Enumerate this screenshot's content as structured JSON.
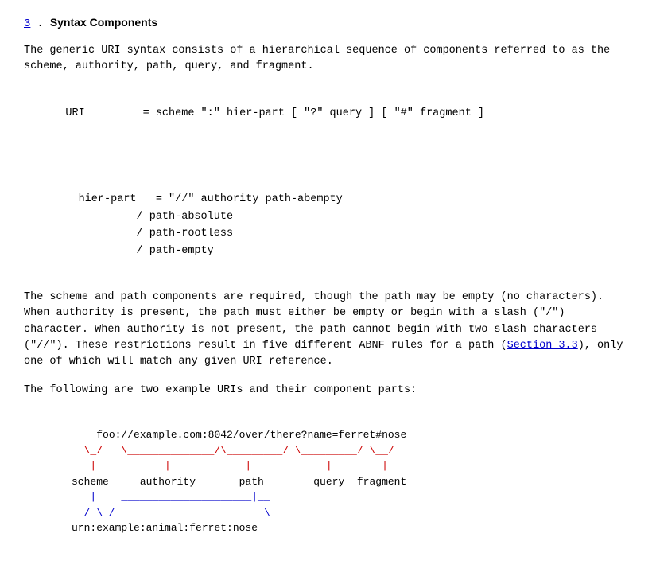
{
  "section": {
    "number": "3",
    "title": "Syntax Components"
  },
  "paragraphs": {
    "intro": "The generic URI syntax consists of a hierarchical sequence of\ncomponents referred to as the scheme, authority, path, query, and\nfragment.",
    "body1": "The scheme and path components are required, though the path may be\nempty (no characters).  When authority is present, the path must\neither be empty or begin with a slash (\"/\") character.  When\nauthority is not present, the path cannot begin with two slash\ncharacters (\"//\").  These restrictions result in five different ABNF\nrules for a path (",
    "section_link": "Section 3.3",
    "body1_cont": "), only one of which will match any\ngiven URI reference.",
    "body2": "The following are two example URIs and their component parts:"
  },
  "grammar": {
    "uri_line": "URI         = scheme \":\" hier-part [ \"?\" query ] [ \"#\" fragment ]",
    "hier_part_label": "hier-part   =",
    "hier_part_lines": [
      "\"//\" authority path-abempty",
      "/ path-absolute",
      "/ path-rootless",
      "/ path-empty"
    ]
  },
  "diagram": {
    "uri1": "foo://example.com:8042/over/there?name=ferret#nose",
    "line1": "  \\_/   \\______________/\\_________/ \\_________/ \\__/",
    "line2": "   |           |            |            |        |",
    "labels1": "scheme     authority       path        query  fragment",
    "line3": "   |    _____________________|__",
    "line4": "  / \\ /                        \\",
    "uri2": "urn:example:animal:ferret:nose"
  }
}
